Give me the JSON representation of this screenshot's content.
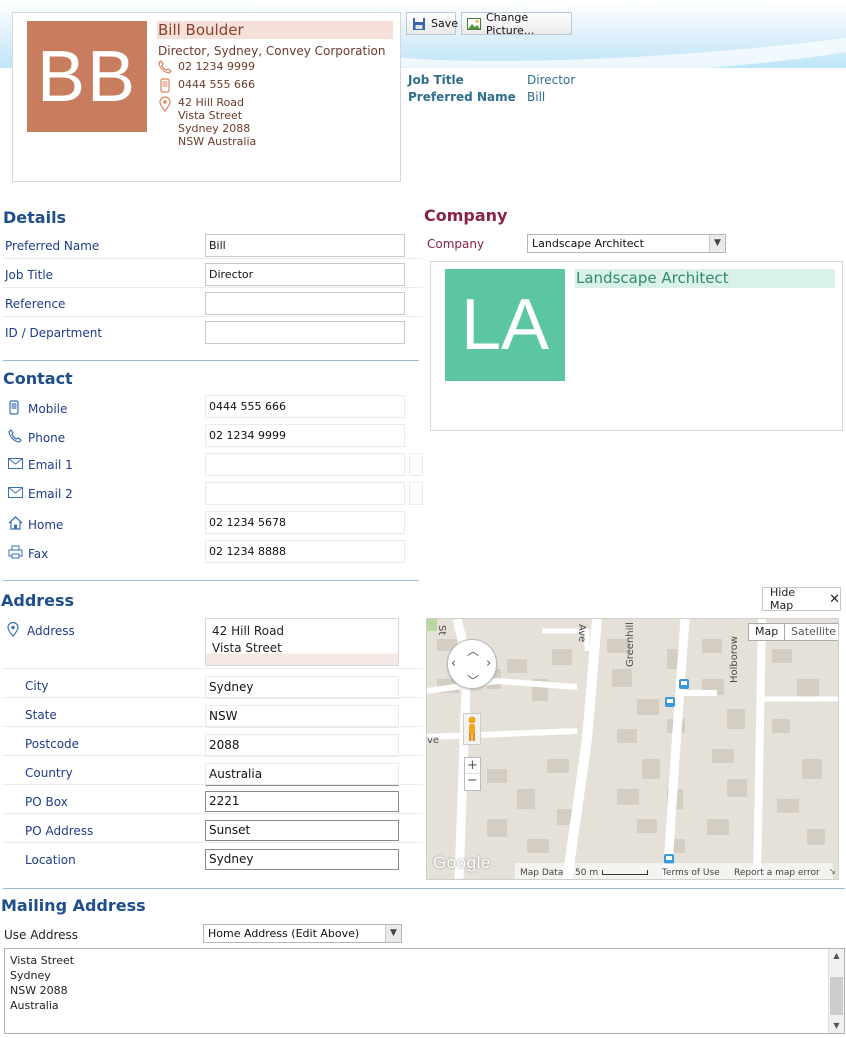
{
  "contact_card": {
    "initials": "BB",
    "name": "Bill Boulder",
    "role": "Director, Sydney, Convey Corporation",
    "phone": "02 1234 9999",
    "mobile": "0444 555 666",
    "address_lines": [
      "42 Hill Road",
      "Vista Street",
      "Sydney 2088",
      "NSW Australia"
    ]
  },
  "toolbar": {
    "save_label": "Save",
    "change_picture_label": "Change Picture..."
  },
  "summary": {
    "job_title_label": "Job Title",
    "job_title_value": "Director",
    "preferred_name_label": "Preferred Name",
    "preferred_name_value": "Bill"
  },
  "details": {
    "title": "Details",
    "fields": [
      {
        "label": "Preferred Name",
        "value": "Bill"
      },
      {
        "label": "Job Title",
        "value": "Director"
      },
      {
        "label": "Reference",
        "value": ""
      },
      {
        "label": "ID / Department",
        "value": ""
      }
    ]
  },
  "company": {
    "title": "Company",
    "label": "Company",
    "selected": "Landscape Architect",
    "initials": "LA",
    "name": "Landscape Architect",
    "colors": {
      "avatar": "#5cc6a2"
    }
  },
  "contact": {
    "title": "Contact",
    "fields": [
      {
        "label": "Mobile",
        "value": "0444 555 666",
        "icon": "mobile-icon"
      },
      {
        "label": "Phone",
        "value": "02 1234 9999",
        "icon": "phone-icon"
      },
      {
        "label": "Email 1",
        "value": "",
        "icon": "email-icon"
      },
      {
        "label": "Email 2",
        "value": "",
        "icon": "email-icon"
      },
      {
        "label": "Home",
        "value": "02 1234 5678",
        "icon": "home-icon"
      },
      {
        "label": "Fax",
        "value": "02 1234 8888",
        "icon": "fax-icon"
      }
    ]
  },
  "address": {
    "title": "Address",
    "hide_map_label": "Hide Map",
    "street_label": "Address",
    "street_lines": [
      "42 Hill Road",
      "Vista Street"
    ],
    "fields": [
      {
        "label": "City",
        "value": "Sydney"
      },
      {
        "label": "State",
        "value": "NSW"
      },
      {
        "label": "Postcode",
        "value": "2088"
      },
      {
        "label": "Country",
        "value": "Australia"
      },
      {
        "label": "PO Box",
        "value": "2221"
      },
      {
        "label": "PO Address",
        "value": "Sunset"
      },
      {
        "label": "Location",
        "value": "Sydney"
      }
    ]
  },
  "map": {
    "map_button": "Map",
    "satellite_button": "Satellite",
    "street_labels": [
      "St",
      "Ave",
      "Greenhill",
      "Holborow",
      "ve"
    ],
    "logo": "Google",
    "footer": {
      "map_data": "Map Data",
      "scale": "50 m",
      "terms": "Terms of Use",
      "report": "Report a map error"
    }
  },
  "mailing": {
    "title": "Mailing Address",
    "use_address_label": "Use Address",
    "use_address_selected": "Home Address (Edit Above)",
    "text_lines": [
      "Vista Street",
      "Sydney",
      "NSW 2088",
      "Australia"
    ]
  }
}
